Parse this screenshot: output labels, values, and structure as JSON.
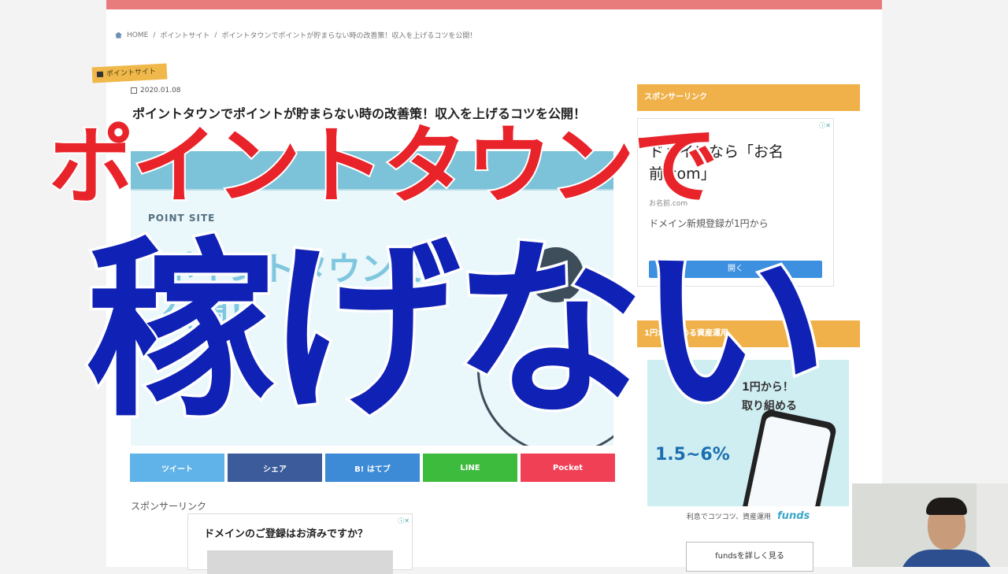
{
  "breadcrumb": {
    "home": "HOME",
    "sep": "/",
    "category": "ポイントサイト",
    "current": "ポイントタウンでポイントが貯まらない時の改善策！収入を上げるコツを公開！"
  },
  "article": {
    "category_label": "ポイントサイト",
    "date": "2020.01.08",
    "title": "ポイントタウンでポイントが貯まらない時の改善策！収入を上げるコツを公開！",
    "eyecatch": {
      "label": "POINT SITE",
      "big_text": "ポイントタウンで\n公開！"
    }
  },
  "share": [
    {
      "label": "ツイート",
      "color": "#5fb3e8"
    },
    {
      "label": "シェア",
      "color": "#3b5b9a"
    },
    {
      "label": "B! はてブ",
      "color": "#3d8ad6"
    },
    {
      "label": "LINE",
      "color": "#3dbb3d"
    },
    {
      "label": "Pocket",
      "color": "#ef4056"
    }
  ],
  "sponsor": {
    "label": "スポンサーリンク",
    "ad_text": "ドメインのご登録はお済みですか？"
  },
  "sidebar": {
    "sponsor_header": "スポンサーリンク",
    "ad": {
      "headline": "ドメインなら「お名前.com」",
      "sub": "お名前.com",
      "desc": "ドメイン新規登録が1円から",
      "button": "開く"
    },
    "section2_header": "1円から始める資産運用",
    "funds_banner": {
      "line1": "1円から！",
      "line2": "取り組める",
      "rate": "1.5~6%",
      "footer": "利息でコツコツ、資産運用",
      "brand": "funds"
    },
    "funds_button": "fundsを詳しく見る"
  },
  "overlay": {
    "line1": "ポイントタウンで",
    "line2": "稼げない"
  }
}
